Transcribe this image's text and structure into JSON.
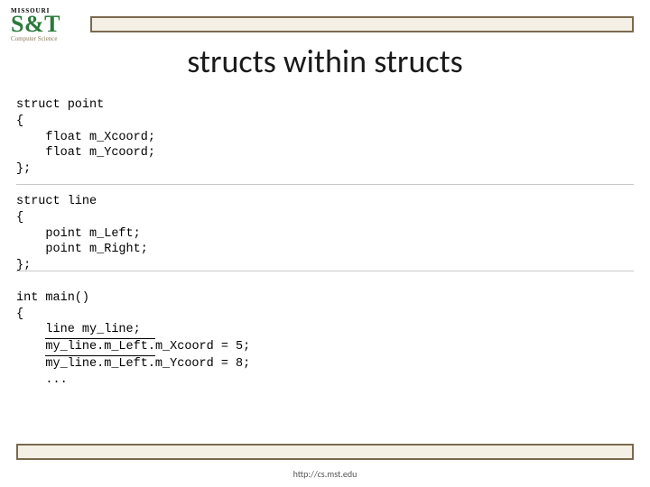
{
  "logo": {
    "missouri": "MISSOURI",
    "st": "S&T",
    "cs": "Computer Science"
  },
  "title": "structs within structs",
  "code": {
    "struct_point_decl": "struct point",
    "brace_open": "{",
    "point_x": "    float m_Xcoord;",
    "point_y": "    float m_Ycoord;",
    "brace_close_semi": "};",
    "struct_line_decl": "struct line",
    "line_left": "    point m_Left;",
    "line_right": "    point m_Right;",
    "main_decl": "int main()",
    "main_open": "{",
    "main_l1": "    line my_line;",
    "main_l2_pre": "    ",
    "main_l2_box": "my_line.m_Left.",
    "main_l2_post": "m_Xcoord = 5;",
    "main_l3": "    my_line.m_Left.m_Ycoord = 8;",
    "main_l4": "    ..."
  },
  "footer": "http://cs.mst.edu"
}
